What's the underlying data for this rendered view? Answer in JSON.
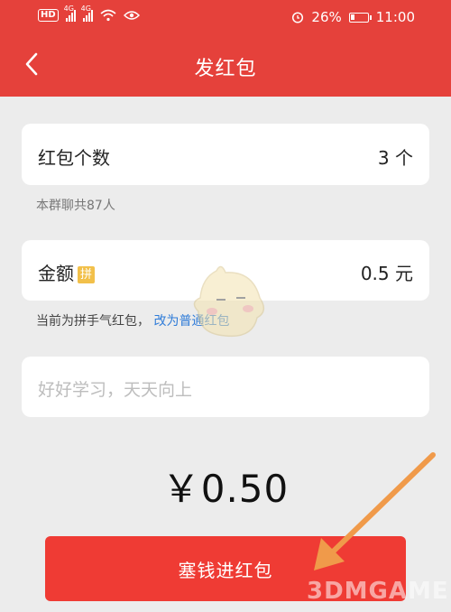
{
  "status_bar": {
    "hd": "HD",
    "signal_1_tag": "4G",
    "signal_2_tag": "4G",
    "battery": "26%",
    "battery_level": 0.26,
    "time": "11:00"
  },
  "nav": {
    "title": "发红包"
  },
  "count_card": {
    "label": "红包个数",
    "value": "3 个"
  },
  "group_hint": "本群聊共87人",
  "amount_card": {
    "label": "金额",
    "badge": "拼",
    "value": "0.5 元"
  },
  "mode_hint": {
    "text": "当前为拼手气红包，",
    "link": "改为普通红包"
  },
  "message": {
    "placeholder": "好好学习，天天向上"
  },
  "total": "￥0.50",
  "submit_label": "塞钱进红包",
  "watermark": "3DMGAME",
  "colors": {
    "header": "#e5413b",
    "button": "#ef3b34",
    "link": "#2e7bd8",
    "badge": "#f2c04a"
  }
}
